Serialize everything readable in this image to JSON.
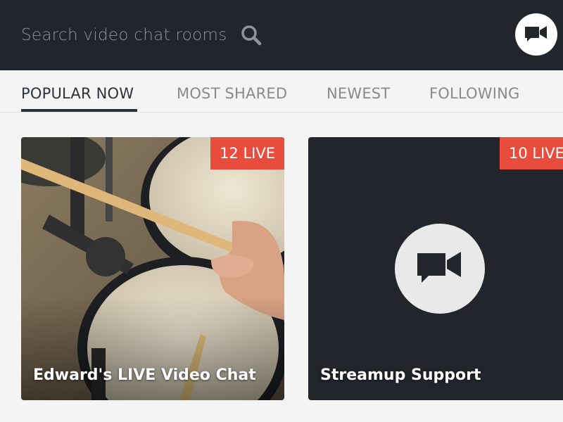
{
  "search": {
    "placeholder": "Search video chat rooms"
  },
  "tabs": [
    {
      "label": "POPULAR NOW",
      "active": true
    },
    {
      "label": "MOST SHARED",
      "active": false
    },
    {
      "label": "NEWEST",
      "active": false
    },
    {
      "label": "FOLLOWING",
      "active": false
    }
  ],
  "rooms": [
    {
      "title": "Edward's LIVE Video Chat",
      "live_badge": "12 LIVE",
      "thumbnail": "drum-kit-photo"
    },
    {
      "title": "Streamup Support",
      "live_badge": "10 LIVE",
      "thumbnail": "video-camera-icon"
    }
  ],
  "colors": {
    "header_bg": "#22252c",
    "accent_live": "#e84c3d",
    "active_tab": "#2f3238",
    "inactive_tab": "#8a8a8a",
    "page_bg": "#f4f4f4"
  },
  "icons": {
    "search": "search-icon",
    "header_action": "video-camera-icon",
    "room_placeholder": "video-camera-icon"
  }
}
